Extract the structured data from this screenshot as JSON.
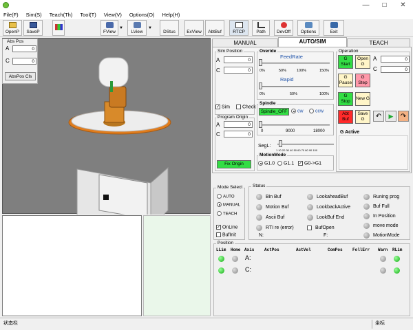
{
  "menu": [
    "File(F)",
    "Sim(S)",
    "Teach(Th)",
    "Tool(T)",
    "View(V)",
    "Options(O)",
    "Help(H)"
  ],
  "toolbar": {
    "open": "OpenP",
    "save": "SaveP",
    "fview": "FView",
    "lview": "LView",
    "dstus": "DStus",
    "exview": "ExView",
    "abtbuf": "AbtBuf",
    "rtcp": "RTCP",
    "path": "Path",
    "devoff": "DevOff",
    "options": "Options",
    "exit": "Exit"
  },
  "abs_pos": {
    "title": "Abs Pos",
    "axes": [
      {
        "label": "A",
        "value": "0"
      },
      {
        "label": "C",
        "value": "0"
      }
    ],
    "clear_btn": "AbsPos Cls"
  },
  "tabs": [
    "MANUAL",
    "AUTO/SIM",
    "TEACH"
  ],
  "sim_position": {
    "title": "Sim Position",
    "axes": [
      {
        "label": "A",
        "value": "0"
      },
      {
        "label": "C",
        "value": "0"
      }
    ],
    "sim": "Sim",
    "check": "Check"
  },
  "program_origin": {
    "title": "Program Origin",
    "axes": [
      {
        "label": "A",
        "value": "0"
      },
      {
        "label": "C",
        "value": "0"
      }
    ],
    "btn": "Fix Origin"
  },
  "override": {
    "title": "Overide",
    "feedrate": "FeedRate",
    "feed_ticks": [
      "0%",
      "50%",
      "100%",
      "150%"
    ],
    "rapid": "Rapid",
    "rapid_ticks": [
      "0%",
      "50%",
      "100%"
    ]
  },
  "spindle": {
    "title": "Spindle",
    "btn": "Spindle_OFF",
    "cw": "cw",
    "ccw": "ccw",
    "ticks": [
      "0",
      "9000",
      "18000"
    ]
  },
  "segl": {
    "label": "SegL:",
    "ticks": "1 10 20 30 40 50 60 70 80 90 100"
  },
  "motion_mode": {
    "title": "MotionMode",
    "options": [
      "G1.0",
      "G1.1",
      "G0->G1"
    ]
  },
  "operation": {
    "title": "Operation",
    "buttons": [
      "G Start",
      "Open G",
      "G Pause",
      "G Step",
      "G Stop",
      "New G",
      "Abt Buf",
      "Save G"
    ],
    "axes": [
      {
        "label": "A",
        "value": "0"
      },
      {
        "label": "C",
        "value": "0"
      }
    ],
    "g_active": "G Active",
    "colors": {
      "green": "#33dd44",
      "pink": "#ff99aa",
      "red": "#ff2a2a",
      "light": "#fff5c8",
      "orange": "#f4b183"
    }
  },
  "mode_select": {
    "title": "Mode Select",
    "options": [
      "AUTO",
      "MANUAL",
      "TEACH"
    ],
    "selected": "MANUAL",
    "online": "OnLine",
    "bufinit": "BufInit"
  },
  "status": {
    "title": "Status",
    "col1": [
      "Bin Buf",
      "Motion Buf",
      "Ascii Buf",
      "RTI re (error)"
    ],
    "col2": [
      "LookaheadBuf",
      "LookbackActive",
      "LookBuf End",
      "BufOpen"
    ],
    "col3": [
      "Runing prog",
      "Buf Full",
      "In Position",
      "move mode",
      "MotionMode"
    ],
    "n_label": "N:",
    "f_label": "F:"
  },
  "position": {
    "title": "Position",
    "headers": [
      "LLim",
      "Home",
      "Axis",
      "ActPos",
      "ActVel",
      "ComPos",
      "FollErr",
      "Warn",
      "RLim"
    ],
    "rows": [
      "A:",
      "C:"
    ]
  },
  "statusbar": {
    "left": "状态栏",
    "right": "坐标"
  }
}
